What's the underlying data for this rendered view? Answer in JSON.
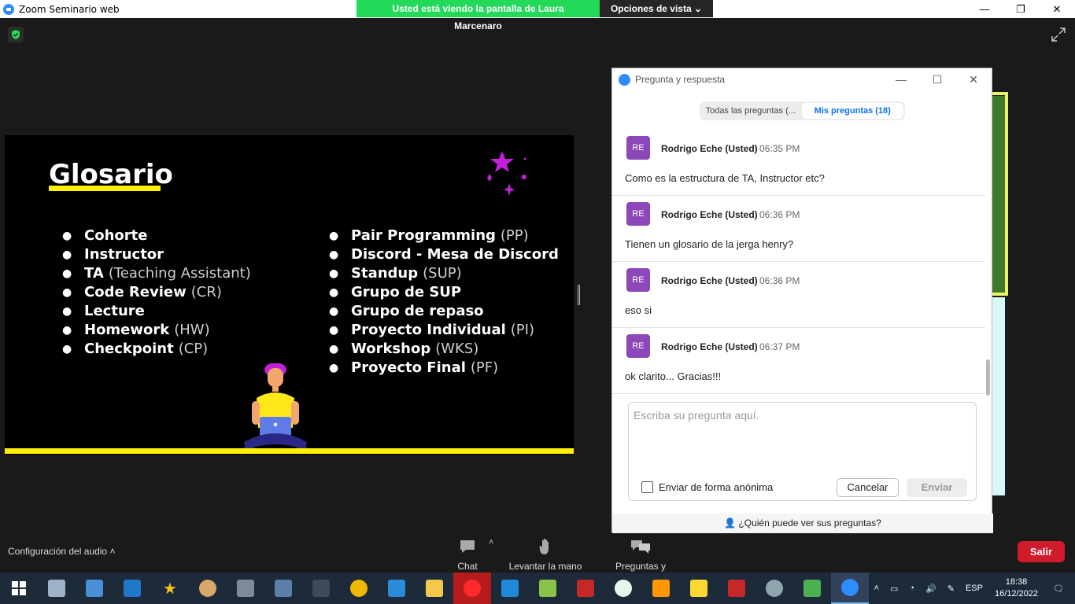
{
  "window": {
    "title": "Zoom Seminario web",
    "share_banner": "Usted está viendo la pantalla de Laura Marcenaro",
    "view_options": "Opciones de vista"
  },
  "slide": {
    "heading": "Glosario",
    "col1": [
      {
        "term": "Cohorte",
        "abbr": ""
      },
      {
        "term": "Instructor",
        "abbr": ""
      },
      {
        "term": "TA",
        "abbr": "(Teaching Assistant)"
      },
      {
        "term": "Code Review",
        "abbr": "(CR)"
      },
      {
        "term": "Lecture",
        "abbr": ""
      },
      {
        "term": "Homework",
        "abbr": "(HW)"
      },
      {
        "term": "Checkpoint",
        "abbr": "(CP)"
      }
    ],
    "col2": [
      {
        "term": "Pair Programming",
        "abbr": "(PP)"
      },
      {
        "term": "Discord - Mesa de Discord",
        "abbr": ""
      },
      {
        "term": "Standup",
        "abbr": "(SUP)"
      },
      {
        "term": "Grupo de SUP",
        "abbr": ""
      },
      {
        "term": "Grupo de repaso",
        "abbr": ""
      },
      {
        "term": "Proyecto Individual",
        "abbr": "(PI)"
      },
      {
        "term": "Workshop",
        "abbr": "(WKS)"
      },
      {
        "term": "Proyecto Final",
        "abbr": "(PF)"
      }
    ]
  },
  "qa": {
    "title": "Pregunta y respuesta",
    "tab_all": "Todas las preguntas (...",
    "tab_mine": "Mis preguntas (18)",
    "questions": [
      {
        "initials": "RE",
        "name": "Rodrigo Eche (Usted)",
        "time": "06:35 PM",
        "text": "Como es la estructura de TA, Instructor etc?"
      },
      {
        "initials": "RE",
        "name": "Rodrigo Eche (Usted)",
        "time": "06:36 PM",
        "text": "Tienen un glosario de la jerga henry?"
      },
      {
        "initials": "RE",
        "name": "Rodrigo Eche (Usted)",
        "time": "06:36 PM",
        "text": "eso si"
      },
      {
        "initials": "RE",
        "name": "Rodrigo Eche (Usted)",
        "time": "06:37 PM",
        "text": "ok clarito... Gracias!!!"
      }
    ],
    "input_placeholder": "Escriba su pregunta aquí.",
    "anonymous_label": "Enviar de forma anónima",
    "cancel": "Cancelar",
    "send": "Enviar",
    "who_can_see": "¿Quién puede ver sus preguntas?"
  },
  "controls": {
    "audio": "Configuración del audio",
    "chat": "Chat",
    "raise_hand": "Levantar la mano",
    "qa": "Preguntas y respuestas",
    "leave": "Salir"
  },
  "taskbar": {
    "lang": "ESP",
    "time": "18:38",
    "date": "16/12/2022"
  },
  "colors": {
    "share_green": "#23d959",
    "zoom_blue": "#2d8cff",
    "avatar_purple": "#8c47b8",
    "leave_red": "#d11a2a",
    "slide_yellow": "#ffef00"
  }
}
